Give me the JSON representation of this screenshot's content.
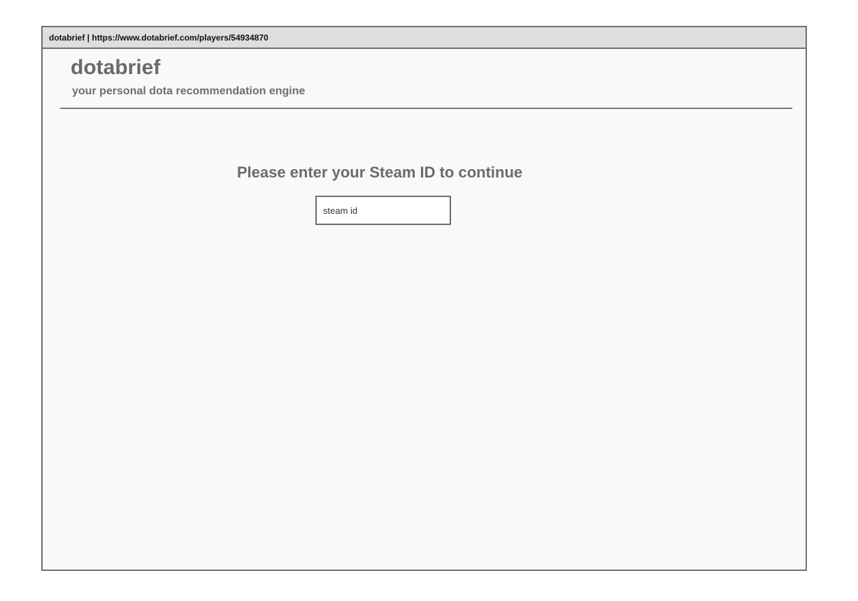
{
  "window": {
    "title": "dotabrief | https://www.dotabrief.com/players/54934870"
  },
  "header": {
    "brand": "dotabrief",
    "tagline": "your personal dota recommendation engine"
  },
  "main": {
    "prompt": "Please enter your Steam ID to continue",
    "steam_input": {
      "value": "",
      "placeholder": "steam id"
    }
  },
  "colors": {
    "titlebar_bg": "#dedede",
    "page_bg": "#f9f9f9",
    "text_gray": "#6b6b6b",
    "border": "#707070"
  }
}
